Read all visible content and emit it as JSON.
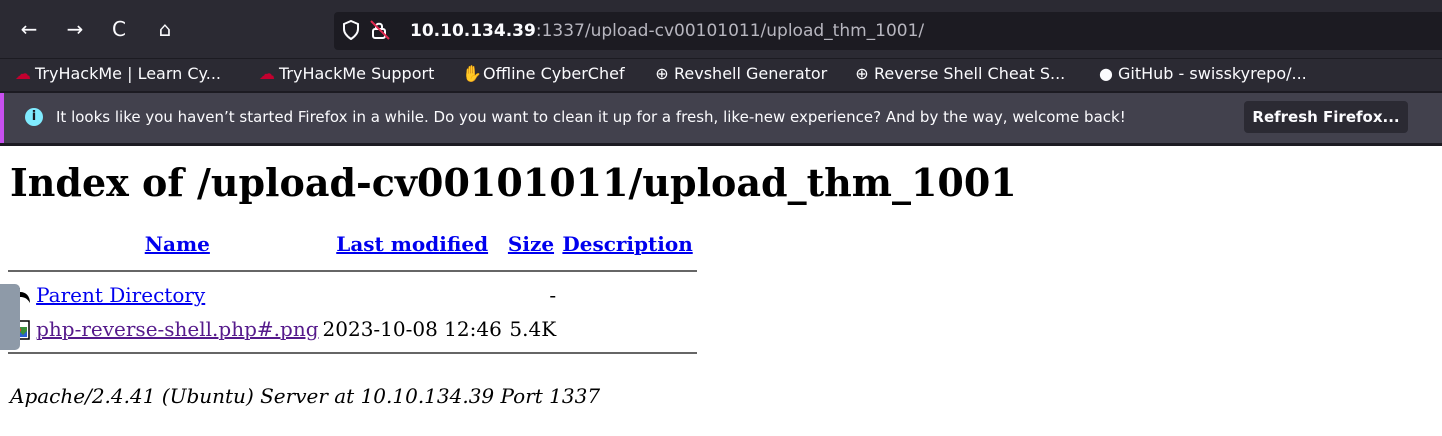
{
  "browser": {
    "nav": {
      "back": "←",
      "forward": "→",
      "reload": "C",
      "home": "⌂"
    },
    "url": {
      "host": "10.10.134.39",
      "path": ":1337/upload-cv00101011/upload_thm_1001/"
    },
    "bookmarks": [
      {
        "icon": "☁",
        "label": "TryHackMe | Learn Cy..."
      },
      {
        "icon": "☁",
        "label": "TryHackMe Support"
      },
      {
        "icon": "✋",
        "label": "Offline CyberChef"
      },
      {
        "icon": "⊕",
        "label": "Revshell Generator"
      },
      {
        "icon": "⊕",
        "label": "Reverse Shell Cheat S..."
      },
      {
        "icon": "●",
        "label": "GitHub - swisskyrepo/..."
      }
    ],
    "notice": {
      "text": "It looks like you haven’t started Firefox in a while. Do you want to clean it up for a fresh, like-new experience? And by the way, welcome back!",
      "button": "Refresh Firefox..."
    }
  },
  "page": {
    "title": "Index of /upload-cv00101011/upload_thm_1001",
    "columns": {
      "name": "Name",
      "modified": "Last modified",
      "size": "Size",
      "description": "Description"
    },
    "rows": [
      {
        "name": "Parent Directory",
        "modified": "",
        "size": "-",
        "description": ""
      },
      {
        "name": "php-reverse-shell.php#.png",
        "modified": "2023-10-08 12:46",
        "size": "5.4K",
        "description": ""
      }
    ],
    "address": "Apache/2.4.41 (Ubuntu) Server at 10.10.134.39 Port 1337"
  }
}
